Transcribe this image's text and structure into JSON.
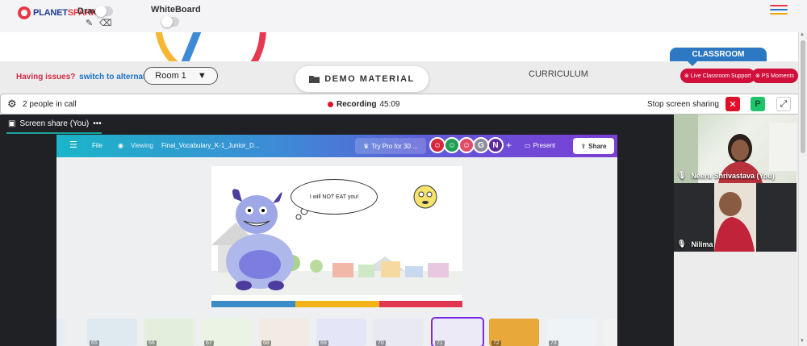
{
  "brand": {
    "name_part1": "PLANET",
    "name_part2": "SPARK"
  },
  "top_tools": {
    "draw_label": "Draw",
    "whiteboard_label": "WhiteBoard"
  },
  "subbar": {
    "issues_text": "Having issues?",
    "alternate_link": "switch to alternate room",
    "room_value": "Room 1",
    "demo_material": "DEMO MATERIAL",
    "curriculum": "CURRICULUM",
    "classroom_tab": "CLASSROOM",
    "live_support": "Live Classroom Support",
    "ps_moments": "PS Moments"
  },
  "call": {
    "people_count": "2 people in call",
    "recording_label": "Recording",
    "recording_time": "45:09",
    "stop_share": "Stop screen sharing",
    "participant_initial": "P"
  },
  "stage": {
    "screen_share_label": "Screen share (You)"
  },
  "canva": {
    "file": "File",
    "viewing": "Viewing",
    "doc_title": "Final_Vocabulary_K-1_Junior_D...",
    "try_pro": "Try Pro for 30 ...",
    "avatar_g": "G",
    "avatar_n": "N",
    "present": "Present",
    "share": "Share",
    "speech_text": "I will NOT EAT you!"
  },
  "thumbnails": [
    "65",
    "66",
    "67",
    "68",
    "69",
    "70",
    "71",
    "72",
    "73"
  ],
  "participants": [
    {
      "name": "Neeru Shrivastava (You)"
    },
    {
      "name": "Nilima"
    }
  ],
  "colors": {
    "accent_red": "#d0103a",
    "classroom_blue": "#2d78c2",
    "canva_purple": "#7d2ae8",
    "stage_bg": "#202124"
  }
}
